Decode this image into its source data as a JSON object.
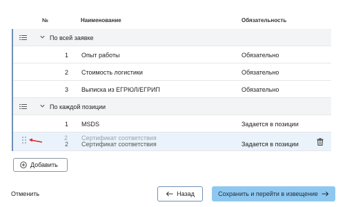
{
  "columns": {
    "num": "№",
    "name": "Наименование",
    "required": "Обязательность"
  },
  "groups": [
    {
      "title": "По всей заявке",
      "items": [
        {
          "num": "1",
          "name": "Опыт работы",
          "required": "Обязательно"
        },
        {
          "num": "2",
          "name": "Стоимость логистики",
          "required": "Обязательно"
        },
        {
          "num": "3",
          "name": "Выписка из ЕГРЮЛ/ЕГРИП",
          "required": "Обязательно"
        }
      ]
    },
    {
      "title": "По каждой позиции",
      "items": [
        {
          "num": "1",
          "name": "MSDS",
          "required": "Задается в позиции"
        }
      ]
    }
  ],
  "drag_row": {
    "ghost_num": "2",
    "ghost_name": "Сертификат соответствия",
    "num": "2",
    "name": "Сертификат соответствия",
    "required": "Задается в позиции"
  },
  "buttons": {
    "add": "Добавить",
    "cancel": "Отменить",
    "back": "Назад",
    "save": "Сохранить и перейти в извещение"
  },
  "icons": {
    "list": "list-icon",
    "chevron": "chevron-down-icon",
    "grip": "drag-handle-icon",
    "arrow": "red-arrow-icon",
    "trash": "trash-icon",
    "plus": "plus-circle-icon",
    "back": "arrow-left-icon",
    "forward": "arrow-right-icon"
  },
  "colors": {
    "accent_border": "#6e8fb5",
    "drag_row_bg": "#eaf3fb",
    "save_button_bg": "#8ec8f0",
    "arrow_red": "#e02020"
  }
}
